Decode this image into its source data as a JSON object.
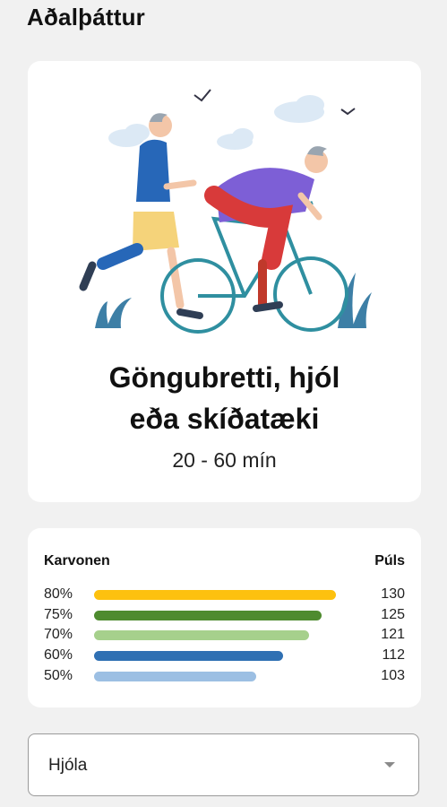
{
  "section": {
    "title": "Aðalþáttur"
  },
  "exercise": {
    "title_line1": "Göngubretti, hjól",
    "title_line2": "eða skíðatæki",
    "duration": "20 - 60 mín"
  },
  "zones": {
    "header_left": "Karvonen",
    "header_right": "Púls",
    "rows": [
      {
        "pct": "80%",
        "pulse": "130",
        "color": "#FDC10F",
        "level": 1.0
      },
      {
        "pct": "75%",
        "pulse": "125",
        "color": "#4E8B2F",
        "level": 0.94
      },
      {
        "pct": "70%",
        "pulse": "121",
        "color": "#A6D08C",
        "level": 0.89
      },
      {
        "pct": "60%",
        "pulse": "112",
        "color": "#2F70B3",
        "level": 0.78
      },
      {
        "pct": "50%",
        "pulse": "103",
        "color": "#9CBFE3",
        "level": 0.67
      }
    ]
  },
  "dropdown": {
    "selected": "Hjóla",
    "icon": "chevron-down-icon"
  },
  "illustration": {
    "icon": "runner-cyclist-illustration"
  }
}
